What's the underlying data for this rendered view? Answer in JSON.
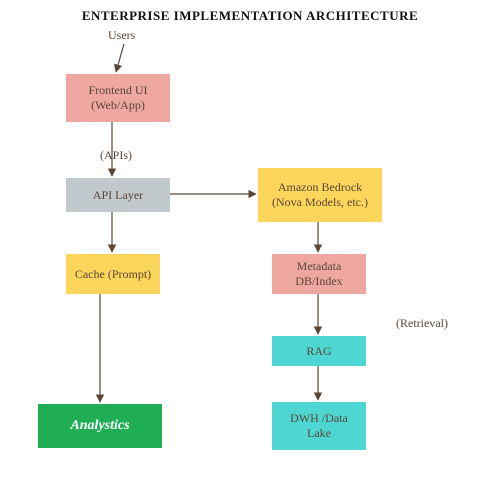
{
  "title": "ENTERPRISE IMPLEMENTATION ARCHITECTURE",
  "labels": {
    "users": "Users",
    "apis": "(APIs)",
    "retrieval": "(Retrieval)"
  },
  "nodes": {
    "frontend": "Frontend UI (Web/App)",
    "api_layer": "API Layer",
    "bedrock": "Amazon Bedrock (Nova Models, etc.)",
    "cache": "Cache (Prompt)",
    "metadata": "Metadata DB/Index",
    "rag": "RAG",
    "dwh": "DWH /Data Lake",
    "analytics": "Analystics"
  },
  "colors": {
    "pink": "#eea7a1",
    "grey": "#c2c9cc",
    "yellow": "#fcd65a",
    "cyan": "#4ed6d2",
    "green": "#1fae54"
  },
  "chart_data": {
    "type": "diagram",
    "title": "ENTERPRISE IMPLEMENTATION ARCHITECTURE",
    "nodes": [
      {
        "id": "users",
        "label": "Users",
        "kind": "actor"
      },
      {
        "id": "frontend",
        "label": "Frontend UI (Web/App)",
        "color": "pink"
      },
      {
        "id": "api",
        "label": "API Layer",
        "color": "grey"
      },
      {
        "id": "bedrock",
        "label": "Amazon Bedrock (Nova Models, etc.)",
        "color": "yellow"
      },
      {
        "id": "cache",
        "label": "Cache (Prompt)",
        "color": "yellow"
      },
      {
        "id": "metadata",
        "label": "Metadata DB/Index",
        "color": "pink"
      },
      {
        "id": "rag",
        "label": "RAG",
        "color": "cyan"
      },
      {
        "id": "dwh",
        "label": "DWH /Data Lake",
        "color": "cyan"
      },
      {
        "id": "analytics",
        "label": "Analystics",
        "color": "green"
      }
    ],
    "edges": [
      {
        "from": "users",
        "to": "frontend"
      },
      {
        "from": "frontend",
        "to": "api",
        "label": "(APIs)"
      },
      {
        "from": "api",
        "to": "cache"
      },
      {
        "from": "api",
        "to": "bedrock"
      },
      {
        "from": "bedrock",
        "to": "metadata"
      },
      {
        "from": "metadata",
        "to": "rag",
        "label": "(Retrieval)"
      },
      {
        "from": "rag",
        "to": "dwh"
      },
      {
        "from": "cache",
        "to": "analytics"
      }
    ]
  }
}
